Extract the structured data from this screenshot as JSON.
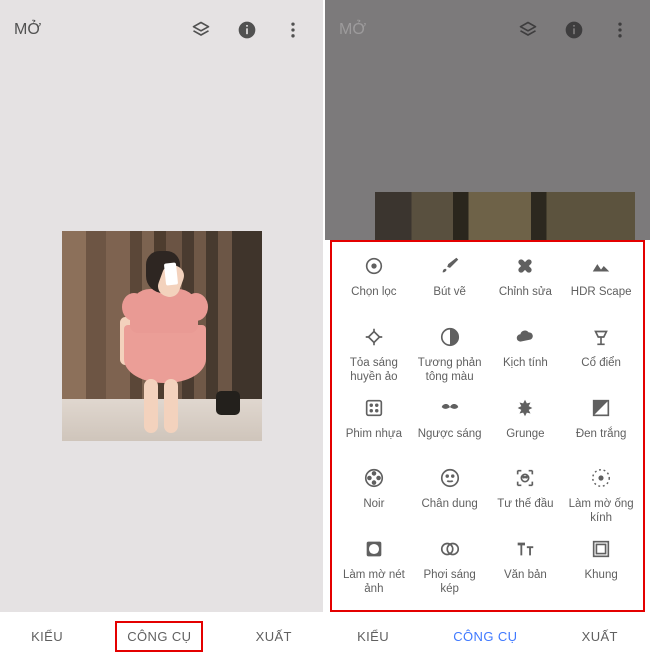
{
  "left": {
    "open_label": "MỞ",
    "tabs": {
      "styles": "KIỂU",
      "tools": "CÔNG CỤ",
      "export": "XUẤT"
    }
  },
  "right": {
    "open_label": "MỞ",
    "tabs": {
      "styles": "KIỂU",
      "tools": "CÔNG CỤ",
      "export": "XUẤT"
    },
    "tools": [
      {
        "id": "selective",
        "label": "Chọn lọc"
      },
      {
        "id": "brush",
        "label": "Bút vẽ"
      },
      {
        "id": "healing",
        "label": "Chỉnh sửa"
      },
      {
        "id": "hdr-scape",
        "label": "HDR Scape"
      },
      {
        "id": "glamour-glow",
        "label": "Tỏa sáng huyền ảo"
      },
      {
        "id": "tonal-contrast",
        "label": "Tương phản tông màu"
      },
      {
        "id": "drama",
        "label": "Kịch tính"
      },
      {
        "id": "vintage",
        "label": "Cổ điển"
      },
      {
        "id": "grainy-film",
        "label": "Phim nhựa"
      },
      {
        "id": "retrolux",
        "label": "Ngược sáng"
      },
      {
        "id": "grunge",
        "label": "Grunge"
      },
      {
        "id": "bw",
        "label": "Đen trắng"
      },
      {
        "id": "noir",
        "label": "Noir"
      },
      {
        "id": "portrait",
        "label": "Chân dung"
      },
      {
        "id": "head-pose",
        "label": "Tư thế đầu"
      },
      {
        "id": "lens-blur",
        "label": "Làm mờ ống kính"
      },
      {
        "id": "vignette",
        "label": "Làm mờ nét ảnh"
      },
      {
        "id": "double-exposure",
        "label": "Phơi sáng kép"
      },
      {
        "id": "text",
        "label": "Văn bản"
      },
      {
        "id": "frames",
        "label": "Khung"
      }
    ]
  },
  "icons": {
    "layers": "layers-icon",
    "info": "info-icon",
    "more": "more-vert-icon"
  }
}
